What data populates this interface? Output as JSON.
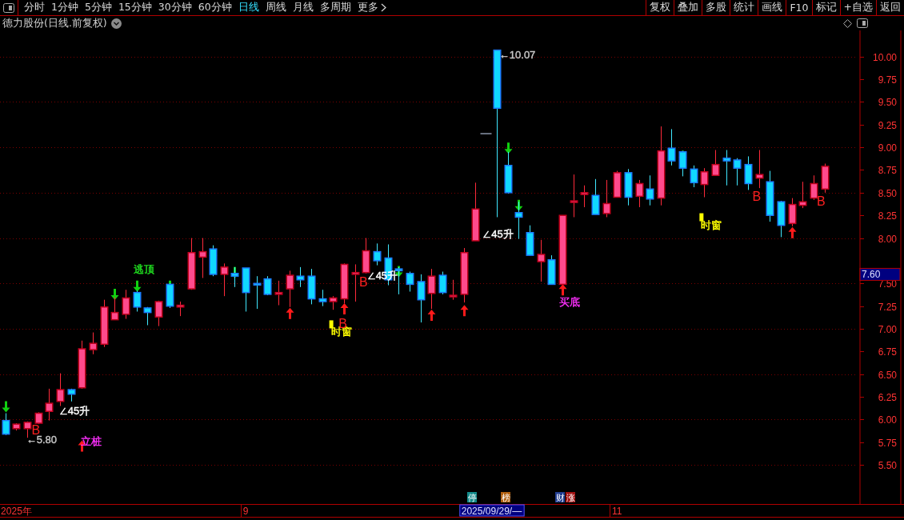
{
  "toolbar": {
    "periods": [
      {
        "label": "分时",
        "selected": false
      },
      {
        "label": "1分钟",
        "selected": false
      },
      {
        "label": "5分钟",
        "selected": false
      },
      {
        "label": "15分钟",
        "selected": false
      },
      {
        "label": "30分钟",
        "selected": false
      },
      {
        "label": "60分钟",
        "selected": false
      },
      {
        "label": "日线",
        "selected": true
      },
      {
        "label": "周线",
        "selected": false
      },
      {
        "label": "月线",
        "selected": false
      },
      {
        "label": "多周期",
        "selected": false
      },
      {
        "label": "更多",
        "selected": false
      }
    ],
    "actions": [
      "复权",
      "叠加",
      "多股",
      "统计",
      "画线",
      "F10",
      "标记",
      "+自选",
      "返回"
    ]
  },
  "title": "德力股份(日线.前复权)",
  "chart_data": {
    "type": "candlestick",
    "ylim": [
      5.07,
      10.27
    ],
    "grid": true,
    "yticks": [
      {
        "value": 10,
        "label": "10.00"
      },
      {
        "value": 9.75,
        "label": "9.75"
      },
      {
        "value": 9.5,
        "label": "9.50"
      },
      {
        "value": 9.25,
        "label": "9.25"
      },
      {
        "value": 9,
        "label": "9.00"
      },
      {
        "value": 8.75,
        "label": "8.75"
      },
      {
        "value": 8.5,
        "label": "8.50"
      },
      {
        "value": 8.25,
        "label": "8.25"
      },
      {
        "value": 8,
        "label": "8.00"
      },
      {
        "value": 7.5,
        "label": "7.50"
      },
      {
        "value": 7.25,
        "label": "7.25"
      },
      {
        "value": 7,
        "label": "7.00"
      },
      {
        "value": 6.75,
        "label": "6.75"
      },
      {
        "value": 6.5,
        "label": "6.50"
      },
      {
        "value": 6.25,
        "label": "6.25"
      },
      {
        "value": 6,
        "label": "6.00"
      },
      {
        "value": 5.75,
        "label": "5.75"
      },
      {
        "value": 5.5,
        "label": "5.50"
      }
    ],
    "categories": [
      null,
      "2025年",
      null,
      null,
      null,
      null,
      null,
      null,
      null,
      null,
      null,
      null,
      null,
      null,
      null,
      null,
      null,
      null,
      null,
      null,
      null,
      null,
      "9",
      null,
      null,
      null,
      null,
      null,
      null,
      null,
      null,
      null,
      null,
      null,
      null,
      null,
      null,
      null,
      null,
      null,
      null,
      null,
      null,
      null,
      null,
      null,
      null,
      null,
      null,
      null,
      null,
      null,
      null,
      null,
      null,
      null,
      "11",
      null,
      null,
      null,
      null,
      null,
      null,
      null,
      null,
      null,
      null,
      null,
      null,
      null,
      null,
      null,
      null,
      null,
      null,
      null
    ],
    "ohlc": [
      [
        5.99,
        6.07,
        5.83,
        5.84
      ],
      [
        5.9,
        5.96,
        5.88,
        5.95
      ],
      [
        5.9,
        5.98,
        5.8,
        5.97
      ],
      [
        5.96,
        6.08,
        5.95,
        6.07
      ],
      [
        6.09,
        6.34,
        5.99,
        6.18
      ],
      [
        6.2,
        6.51,
        6.15,
        6.33
      ],
      [
        6.33,
        6.34,
        6.2,
        6.28
      ],
      [
        6.35,
        6.87,
        6.34,
        6.78
      ],
      [
        6.77,
        6.96,
        6.72,
        6.84
      ],
      [
        6.83,
        7.32,
        6.8,
        7.24
      ],
      [
        7.1,
        7.35,
        7.1,
        7.18
      ],
      [
        7.16,
        7.43,
        7.11,
        7.34
      ],
      [
        7.4,
        7.42,
        7.19,
        7.24
      ],
      [
        7.23,
        7.24,
        7.04,
        7.18
      ],
      [
        7.13,
        7.31,
        7.03,
        7.3
      ],
      [
        7.49,
        7.5,
        7.23,
        7.25
      ],
      [
        7.24,
        7.3,
        7.14,
        7.26
      ],
      [
        7.44,
        8.0,
        7.43,
        7.84
      ],
      [
        7.79,
        8.0,
        7.56,
        7.85
      ],
      [
        7.88,
        7.92,
        7.58,
        7.6
      ],
      [
        7.6,
        7.72,
        7.36,
        7.68
      ],
      [
        7.61,
        7.68,
        7.46,
        7.58
      ],
      [
        7.67,
        7.67,
        7.19,
        7.4
      ],
      [
        7.5,
        7.58,
        7.22,
        7.49
      ],
      [
        7.55,
        7.58,
        7.37,
        7.38
      ],
      [
        7.38,
        7.53,
        7.26,
        7.4
      ],
      [
        7.44,
        7.64,
        7.24,
        7.59
      ],
      [
        7.58,
        7.68,
        7.46,
        7.54
      ],
      [
        7.58,
        7.66,
        7.27,
        7.33
      ],
      [
        7.33,
        7.43,
        7.25,
        7.3
      ],
      [
        7.3,
        7.36,
        7.21,
        7.34
      ],
      [
        7.33,
        7.72,
        7.28,
        7.71
      ],
      [
        7.6,
        7.71,
        7.3,
        7.62
      ],
      [
        7.62,
        8.0,
        7.61,
        7.86
      ],
      [
        7.85,
        7.94,
        7.7,
        7.75
      ],
      [
        7.78,
        7.93,
        7.48,
        7.54
      ],
      [
        7.66,
        7.68,
        7.38,
        7.64
      ],
      [
        7.61,
        7.63,
        7.41,
        7.49
      ],
      [
        7.52,
        7.6,
        7.07,
        7.32
      ],
      [
        7.39,
        7.66,
        7.22,
        7.58
      ],
      [
        7.59,
        7.63,
        7.38,
        7.4
      ],
      [
        7.36,
        7.54,
        7.32,
        7.37
      ],
      [
        7.38,
        7.89,
        7.29,
        7.84
      ],
      [
        7.97,
        8.61,
        7.97,
        8.32
      ],
      [
        9.15,
        9.15,
        9.15,
        9.15
      ],
      [
        10.07,
        10.07,
        8.23,
        9.43
      ],
      [
        8.8,
        8.95,
        8.49,
        8.5
      ],
      [
        8.28,
        8.4,
        7.99,
        8.23
      ],
      [
        8.06,
        8.14,
        7.81,
        7.81
      ],
      [
        7.74,
        7.98,
        7.52,
        7.82
      ],
      [
        7.76,
        7.81,
        7.49,
        7.49
      ],
      [
        7.49,
        8.25,
        7.49,
        8.25
      ],
      [
        8.4,
        8.7,
        8.23,
        8.41
      ],
      [
        8.48,
        8.58,
        8.34,
        8.5
      ],
      [
        8.47,
        8.65,
        8.26,
        8.26
      ],
      [
        8.27,
        8.64,
        8.23,
        8.38
      ],
      [
        8.45,
        8.74,
        8.45,
        8.72
      ],
      [
        8.72,
        8.76,
        8.36,
        8.45
      ],
      [
        8.46,
        8.64,
        8.34,
        8.6
      ],
      [
        8.54,
        8.69,
        8.36,
        8.43
      ],
      [
        8.44,
        9.23,
        8.36,
        8.96
      ],
      [
        8.99,
        9.2,
        8.8,
        8.85
      ],
      [
        8.95,
        8.96,
        8.68,
        8.77
      ],
      [
        8.76,
        8.8,
        8.56,
        8.61
      ],
      [
        8.59,
        8.77,
        8.45,
        8.73
      ],
      [
        8.69,
        8.97,
        8.69,
        8.81
      ],
      [
        8.88,
        8.97,
        8.58,
        8.85
      ],
      [
        8.86,
        8.88,
        8.58,
        8.77
      ],
      [
        8.81,
        8.9,
        8.53,
        8.6
      ],
      [
        8.66,
        8.97,
        8.55,
        8.7
      ],
      [
        8.62,
        8.74,
        8.18,
        8.25
      ],
      [
        8.4,
        8.41,
        8.01,
        8.14
      ],
      [
        8.16,
        8.44,
        8.13,
        8.37
      ],
      [
        8.36,
        8.62,
        8.33,
        8.4
      ],
      [
        8.44,
        8.69,
        8.42,
        8.6
      ],
      [
        8.54,
        8.82,
        8.5,
        8.79
      ]
    ]
  },
  "price_tag": "7.60",
  "chart_labels": [
    {
      "kind": "label",
      "text": "←10.07",
      "color": "#c8c8c8"
    },
    {
      "kind": "label",
      "text": "←5.80",
      "color": "#c8c8c8"
    },
    {
      "kind": "label",
      "text": "∠45升",
      "color": "#ffffff"
    },
    {
      "kind": "label",
      "text": "∠45升",
      "color": "#ffffff"
    },
    {
      "kind": "label",
      "text": "∠45升",
      "color": "#ffffff"
    },
    {
      "kind": "label",
      "text": "逃顶",
      "color": "#20e020"
    },
    {
      "kind": "label",
      "text": "立桩",
      "color": "#ff30ff"
    },
    {
      "kind": "window",
      "text": "时窗",
      "color": "#ffff00"
    },
    {
      "kind": "window",
      "text": "时窗",
      "color": "#ffff00"
    },
    {
      "kind": "label",
      "text": "买底",
      "color": "#ff30ff"
    },
    {
      "kind": "signal",
      "text": "B",
      "color": "#ff2020"
    },
    {
      "kind": "signal",
      "text": "B",
      "color": "#ff2020"
    },
    {
      "kind": "signal",
      "text": "B",
      "color": "#ff2020"
    },
    {
      "kind": "signal",
      "text": "B",
      "color": "#ff2020"
    },
    {
      "kind": "signal",
      "text": "B",
      "color": "#ff2020"
    }
  ],
  "event_tags": [
    {
      "text": "停",
      "color": "#138a8a"
    },
    {
      "text": "榜",
      "color": "#b06010"
    },
    {
      "text": "财",
      "color": "#203c90"
    },
    {
      "text": "涨",
      "color": "#a01010"
    }
  ],
  "date_tag": "2025/09/29/—"
}
